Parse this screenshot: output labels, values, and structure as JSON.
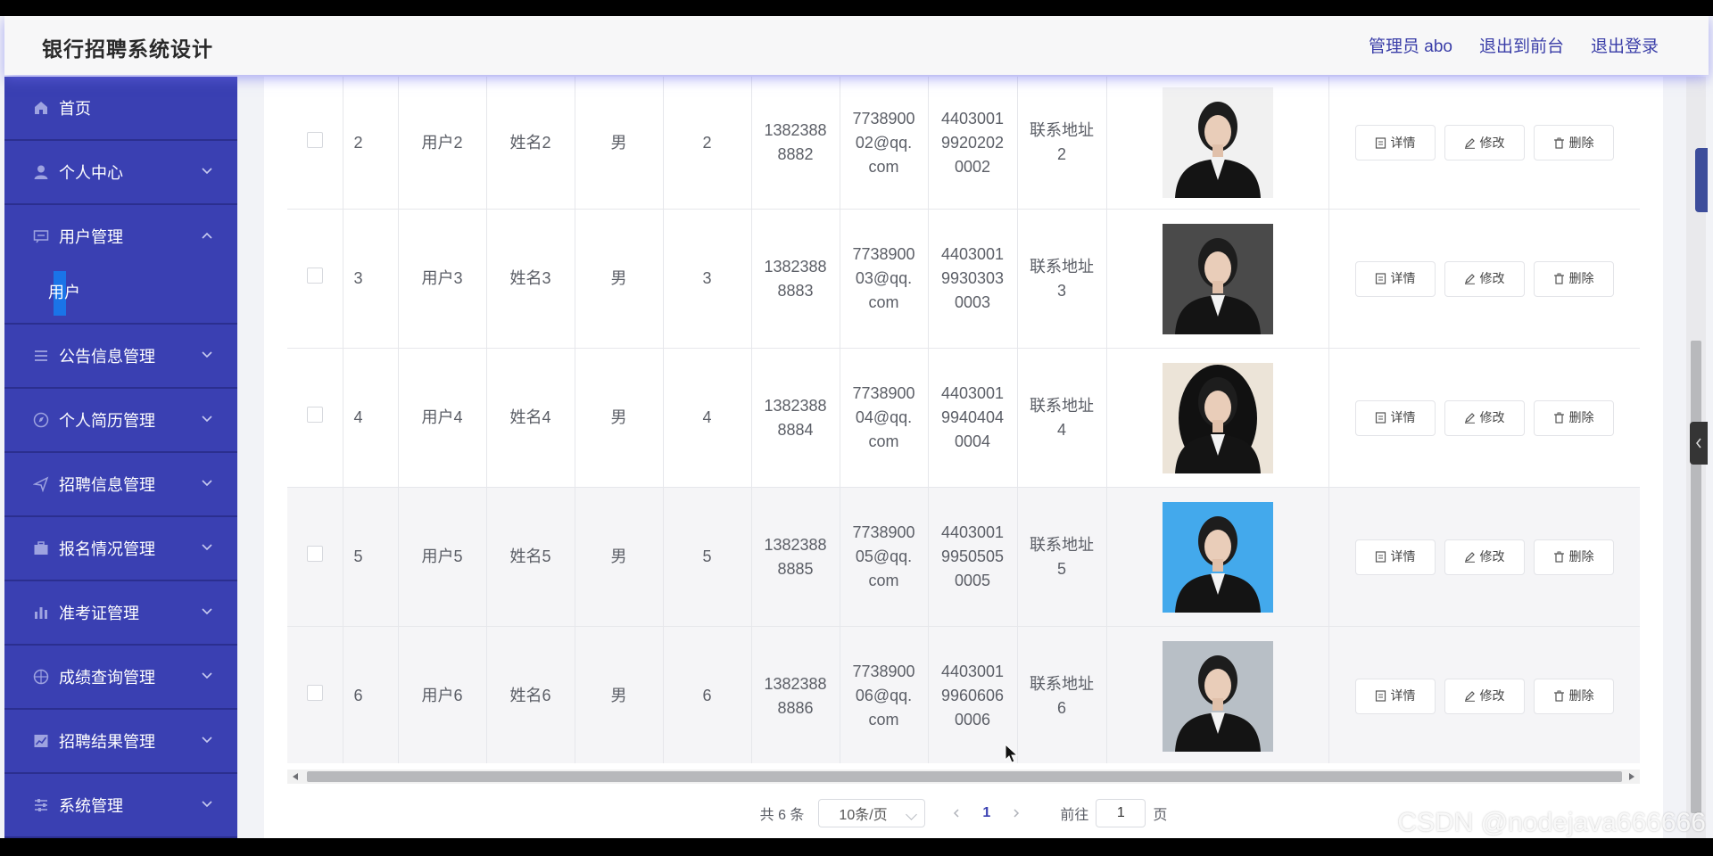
{
  "app": {
    "title": "银行招聘系统设计"
  },
  "header": {
    "admin": "管理员 abo",
    "to_front": "退出到前台",
    "logout": "退出登录"
  },
  "sidebar": {
    "items": [
      {
        "label": "首页",
        "icon": "home-icon"
      },
      {
        "label": "个人中心",
        "icon": "person-icon"
      },
      {
        "label": "用户管理",
        "icon": "chat-icon",
        "expanded": true,
        "children": [
          {
            "label": "用户",
            "active": true
          }
        ]
      },
      {
        "label": "公告信息管理",
        "icon": "menu-icon"
      },
      {
        "label": "个人简历管理",
        "icon": "compass-icon"
      },
      {
        "label": "招聘信息管理",
        "icon": "send-icon"
      },
      {
        "label": "报名情况管理",
        "icon": "briefcase-icon"
      },
      {
        "label": "准考证管理",
        "icon": "bar-chart-icon"
      },
      {
        "label": "成绩查询管理",
        "icon": "target-icon"
      },
      {
        "label": "招聘结果管理",
        "icon": "trend-icon"
      },
      {
        "label": "系统管理",
        "icon": "sliders-icon"
      }
    ]
  },
  "table": {
    "rows": [
      {
        "index": "2",
        "username": "用户2",
        "name": "姓名2",
        "gender": "男",
        "age": "2",
        "phone": [
          "1382388",
          "8882"
        ],
        "email": [
          "7738900",
          "02@qq.",
          "com"
        ],
        "idcard": [
          "4403001",
          "9920202",
          "0002"
        ],
        "address": [
          "联系地址",
          "2"
        ],
        "photo_bg": "#f1f1f1",
        "photo_style": "rect"
      },
      {
        "index": "3",
        "username": "用户3",
        "name": "姓名3",
        "gender": "男",
        "age": "3",
        "phone": [
          "1382388",
          "8883"
        ],
        "email": [
          "7738900",
          "03@qq.",
          "com"
        ],
        "idcard": [
          "4403001",
          "9930303",
          "0003"
        ],
        "address": [
          "联系地址",
          "3"
        ],
        "photo_bg": "#4a4a4a",
        "photo_style": "rect"
      },
      {
        "index": "4",
        "username": "用户4",
        "name": "姓名4",
        "gender": "男",
        "age": "4",
        "phone": [
          "1382388",
          "8884"
        ],
        "email": [
          "7738900",
          "04@qq.",
          "com"
        ],
        "idcard": [
          "4403001",
          "9940404",
          "0004"
        ],
        "address": [
          "联系地址",
          "4"
        ],
        "photo_bg": "#ece4d8",
        "photo_style": "oval"
      },
      {
        "index": "5",
        "username": "用户5",
        "name": "姓名5",
        "gender": "男",
        "age": "5",
        "phone": [
          "1382388",
          "8885"
        ],
        "email": [
          "7738900",
          "05@qq.",
          "com"
        ],
        "idcard": [
          "4403001",
          "9950505",
          "0005"
        ],
        "address": [
          "联系地址",
          "5"
        ],
        "photo_bg": "#43a9ec",
        "photo_style": "rect"
      },
      {
        "index": "6",
        "username": "用户6",
        "name": "姓名6",
        "gender": "男",
        "age": "6",
        "phone": [
          "1382388",
          "8886"
        ],
        "email": [
          "7738900",
          "06@qq.",
          "com"
        ],
        "idcard": [
          "4403001",
          "9960606",
          "0006"
        ],
        "address": [
          "联系地址",
          "6"
        ],
        "photo_bg": "#b8bfc6",
        "photo_style": "rect"
      }
    ],
    "actions": {
      "detail": "详情",
      "edit": "修改",
      "delete": "删除"
    }
  },
  "pagination": {
    "total": "共 6 条",
    "page_size": "10条/页",
    "current": "1",
    "goto_label": "前往",
    "goto_value": "1",
    "page_unit": "页"
  },
  "watermark": "CSDN @nodejava666666",
  "colors": {
    "sidebar": "#3a40b2",
    "accent": "#1a74e8",
    "header_link": "#3a3ea8"
  }
}
